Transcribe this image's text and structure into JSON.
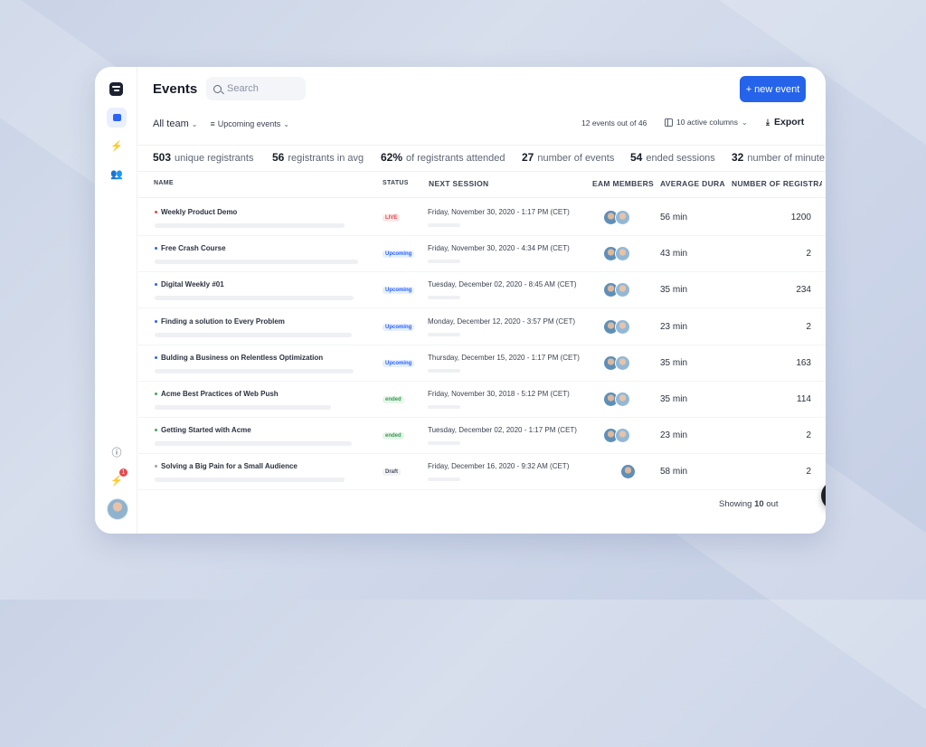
{
  "header": {
    "title": "Events",
    "search_placeholder": "Search",
    "new_event_label": "+ new event"
  },
  "filters": {
    "team_label": "All team",
    "events_filter_label": "Upcoming events",
    "count_label": "12 events out of 46",
    "columns_label": "10 active columns",
    "export_label": "Export"
  },
  "stats": [
    {
      "value": "503",
      "label": "unique registrants"
    },
    {
      "value": "56",
      "label": "registrants in avg"
    },
    {
      "value": "62%",
      "label": "of registrants attended"
    },
    {
      "value": "27",
      "label": "number of events"
    },
    {
      "value": "54",
      "label": "ended sessions"
    },
    {
      "value": "32",
      "label": "number of minute"
    }
  ],
  "columns": {
    "name": "NAME",
    "status": "STATUS",
    "next_session": "NEXT SESSION",
    "team_members": "TEAM MEMBERS",
    "average_duration": "AVERAGE DURA",
    "registrants": "NUMBER OF REGISTRA"
  },
  "rows": [
    {
      "name": "Weekly Product Demo",
      "dot_color": "#e5484d",
      "status": "LIVE",
      "status_type": "live",
      "session": "Friday, November 30, 2020 - 1:17 PM (CET)",
      "avatars": 2,
      "duration": "56 min",
      "registrants": "1200"
    },
    {
      "name": "Free Crash Course",
      "dot_color": "#2a63f6",
      "status": "Upcoming",
      "status_type": "upcoming",
      "session": "Friday, November 30, 2020 - 4:34 PM (CET)",
      "avatars": 2,
      "duration": "43 min",
      "registrants": "2"
    },
    {
      "name": "Digital Weekly #01",
      "dot_color": "#2a63f6",
      "status": "Upcoming",
      "status_type": "upcoming",
      "session": "Tuesday, December 02, 2020 - 8:45 AM (CET)",
      "avatars": 2,
      "duration": "35 min",
      "registrants": "234"
    },
    {
      "name": "Finding a solution to Every Problem",
      "dot_color": "#2a63f6",
      "status": "Upcoming",
      "status_type": "upcoming",
      "session": "Monday, December 12, 2020 - 3:57 PM (CET)",
      "avatars": 2,
      "duration": "23 min",
      "registrants": "2"
    },
    {
      "name": "Bulding a Business on Relentless Optimization",
      "dot_color": "#2a63f6",
      "status": "Upcoming",
      "status_type": "upcoming",
      "session": "Thursday, December 15, 2020 - 1:17 PM (CET)",
      "avatars": 2,
      "duration": "35 min",
      "registrants": "163"
    },
    {
      "name": "Acme Best Practices of Web Push",
      "dot_color": "#46a758",
      "status": "ended",
      "status_type": "ended",
      "session": "Friday, November 30, 2018 - 5:12 PM (CET)",
      "avatars": 2,
      "duration": "35 min",
      "registrants": "114"
    },
    {
      "name": "Getting Started with Acme",
      "dot_color": "#46a758",
      "status": "ended",
      "status_type": "ended",
      "session": "Tuesday, December 02, 2020 - 1:17 PM (CET)",
      "avatars": 2,
      "duration": "23 min",
      "registrants": "2"
    },
    {
      "name": "Solving a Big Pain for a Small Audience",
      "dot_color": "#9aa1ae",
      "status": "Draft",
      "status_type": "draft",
      "session": "Friday, December 16, 2020 - 9:32 AM (CET)",
      "avatars": 1,
      "duration": "58 min",
      "registrants": "2"
    }
  ],
  "footer": {
    "showing_prefix": "Showing",
    "showing_count": "10",
    "showing_suffix": "out",
    "help_label": "?"
  },
  "sidebar": {
    "notification_count": "1"
  }
}
